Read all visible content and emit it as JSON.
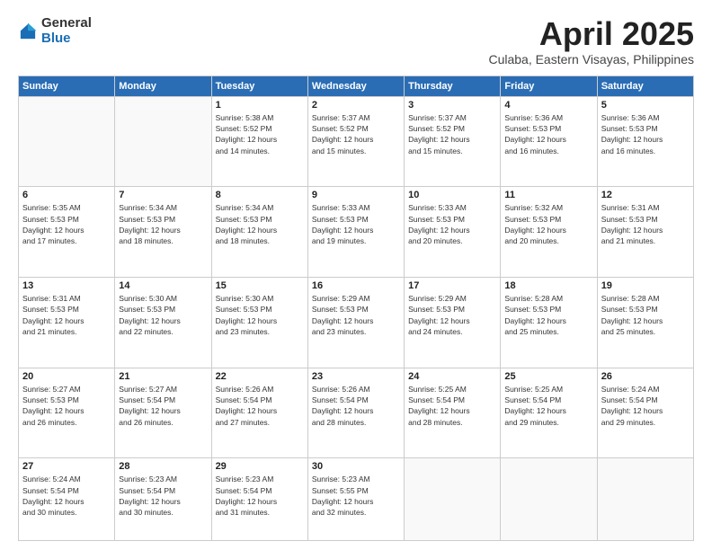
{
  "logo": {
    "general": "General",
    "blue": "Blue"
  },
  "title": "April 2025",
  "subtitle": "Culaba, Eastern Visayas, Philippines",
  "days_header": [
    "Sunday",
    "Monday",
    "Tuesday",
    "Wednesday",
    "Thursday",
    "Friday",
    "Saturday"
  ],
  "weeks": [
    [
      {
        "num": "",
        "sunrise": "",
        "sunset": "",
        "daylight": ""
      },
      {
        "num": "",
        "sunrise": "",
        "sunset": "",
        "daylight": ""
      },
      {
        "num": "1",
        "sunrise": "Sunrise: 5:38 AM",
        "sunset": "Sunset: 5:52 PM",
        "daylight": "Daylight: 12 hours and 14 minutes."
      },
      {
        "num": "2",
        "sunrise": "Sunrise: 5:37 AM",
        "sunset": "Sunset: 5:52 PM",
        "daylight": "Daylight: 12 hours and 15 minutes."
      },
      {
        "num": "3",
        "sunrise": "Sunrise: 5:37 AM",
        "sunset": "Sunset: 5:52 PM",
        "daylight": "Daylight: 12 hours and 15 minutes."
      },
      {
        "num": "4",
        "sunrise": "Sunrise: 5:36 AM",
        "sunset": "Sunset: 5:53 PM",
        "daylight": "Daylight: 12 hours and 16 minutes."
      },
      {
        "num": "5",
        "sunrise": "Sunrise: 5:36 AM",
        "sunset": "Sunset: 5:53 PM",
        "daylight": "Daylight: 12 hours and 16 minutes."
      }
    ],
    [
      {
        "num": "6",
        "sunrise": "Sunrise: 5:35 AM",
        "sunset": "Sunset: 5:53 PM",
        "daylight": "Daylight: 12 hours and 17 minutes."
      },
      {
        "num": "7",
        "sunrise": "Sunrise: 5:34 AM",
        "sunset": "Sunset: 5:53 PM",
        "daylight": "Daylight: 12 hours and 18 minutes."
      },
      {
        "num": "8",
        "sunrise": "Sunrise: 5:34 AM",
        "sunset": "Sunset: 5:53 PM",
        "daylight": "Daylight: 12 hours and 18 minutes."
      },
      {
        "num": "9",
        "sunrise": "Sunrise: 5:33 AM",
        "sunset": "Sunset: 5:53 PM",
        "daylight": "Daylight: 12 hours and 19 minutes."
      },
      {
        "num": "10",
        "sunrise": "Sunrise: 5:33 AM",
        "sunset": "Sunset: 5:53 PM",
        "daylight": "Daylight: 12 hours and 20 minutes."
      },
      {
        "num": "11",
        "sunrise": "Sunrise: 5:32 AM",
        "sunset": "Sunset: 5:53 PM",
        "daylight": "Daylight: 12 hours and 20 minutes."
      },
      {
        "num": "12",
        "sunrise": "Sunrise: 5:31 AM",
        "sunset": "Sunset: 5:53 PM",
        "daylight": "Daylight: 12 hours and 21 minutes."
      }
    ],
    [
      {
        "num": "13",
        "sunrise": "Sunrise: 5:31 AM",
        "sunset": "Sunset: 5:53 PM",
        "daylight": "Daylight: 12 hours and 21 minutes."
      },
      {
        "num": "14",
        "sunrise": "Sunrise: 5:30 AM",
        "sunset": "Sunset: 5:53 PM",
        "daylight": "Daylight: 12 hours and 22 minutes."
      },
      {
        "num": "15",
        "sunrise": "Sunrise: 5:30 AM",
        "sunset": "Sunset: 5:53 PM",
        "daylight": "Daylight: 12 hours and 23 minutes."
      },
      {
        "num": "16",
        "sunrise": "Sunrise: 5:29 AM",
        "sunset": "Sunset: 5:53 PM",
        "daylight": "Daylight: 12 hours and 23 minutes."
      },
      {
        "num": "17",
        "sunrise": "Sunrise: 5:29 AM",
        "sunset": "Sunset: 5:53 PM",
        "daylight": "Daylight: 12 hours and 24 minutes."
      },
      {
        "num": "18",
        "sunrise": "Sunrise: 5:28 AM",
        "sunset": "Sunset: 5:53 PM",
        "daylight": "Daylight: 12 hours and 25 minutes."
      },
      {
        "num": "19",
        "sunrise": "Sunrise: 5:28 AM",
        "sunset": "Sunset: 5:53 PM",
        "daylight": "Daylight: 12 hours and 25 minutes."
      }
    ],
    [
      {
        "num": "20",
        "sunrise": "Sunrise: 5:27 AM",
        "sunset": "Sunset: 5:53 PM",
        "daylight": "Daylight: 12 hours and 26 minutes."
      },
      {
        "num": "21",
        "sunrise": "Sunrise: 5:27 AM",
        "sunset": "Sunset: 5:54 PM",
        "daylight": "Daylight: 12 hours and 26 minutes."
      },
      {
        "num": "22",
        "sunrise": "Sunrise: 5:26 AM",
        "sunset": "Sunset: 5:54 PM",
        "daylight": "Daylight: 12 hours and 27 minutes."
      },
      {
        "num": "23",
        "sunrise": "Sunrise: 5:26 AM",
        "sunset": "Sunset: 5:54 PM",
        "daylight": "Daylight: 12 hours and 28 minutes."
      },
      {
        "num": "24",
        "sunrise": "Sunrise: 5:25 AM",
        "sunset": "Sunset: 5:54 PM",
        "daylight": "Daylight: 12 hours and 28 minutes."
      },
      {
        "num": "25",
        "sunrise": "Sunrise: 5:25 AM",
        "sunset": "Sunset: 5:54 PM",
        "daylight": "Daylight: 12 hours and 29 minutes."
      },
      {
        "num": "26",
        "sunrise": "Sunrise: 5:24 AM",
        "sunset": "Sunset: 5:54 PM",
        "daylight": "Daylight: 12 hours and 29 minutes."
      }
    ],
    [
      {
        "num": "27",
        "sunrise": "Sunrise: 5:24 AM",
        "sunset": "Sunset: 5:54 PM",
        "daylight": "Daylight: 12 hours and 30 minutes."
      },
      {
        "num": "28",
        "sunrise": "Sunrise: 5:23 AM",
        "sunset": "Sunset: 5:54 PM",
        "daylight": "Daylight: 12 hours and 30 minutes."
      },
      {
        "num": "29",
        "sunrise": "Sunrise: 5:23 AM",
        "sunset": "Sunset: 5:54 PM",
        "daylight": "Daylight: 12 hours and 31 minutes."
      },
      {
        "num": "30",
        "sunrise": "Sunrise: 5:23 AM",
        "sunset": "Sunset: 5:55 PM",
        "daylight": "Daylight: 12 hours and 32 minutes."
      },
      {
        "num": "",
        "sunrise": "",
        "sunset": "",
        "daylight": ""
      },
      {
        "num": "",
        "sunrise": "",
        "sunset": "",
        "daylight": ""
      },
      {
        "num": "",
        "sunrise": "",
        "sunset": "",
        "daylight": ""
      }
    ]
  ]
}
